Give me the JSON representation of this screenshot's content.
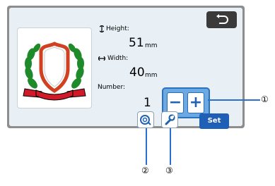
{
  "screen": {
    "height_label": "Height:",
    "height_value": "51",
    "height_unit": "mm",
    "width_label": "Width:",
    "width_value": "40",
    "width_unit": "mm",
    "number_label": "Number:",
    "number_value": "1",
    "minus_label": "−",
    "plus_label": "+",
    "set_label": "Set"
  },
  "callouts": {
    "c1": "①",
    "c2": "②",
    "c3": "③"
  },
  "colors": {
    "accent": "#2a6fd0",
    "screen_bg": "#e8f0f5",
    "frame": "#8d8d8d"
  },
  "icons": [
    "back-arrow-icon",
    "height-arrow-icon",
    "width-arrow-icon",
    "cutting-mode-icon",
    "wrench-icon"
  ]
}
